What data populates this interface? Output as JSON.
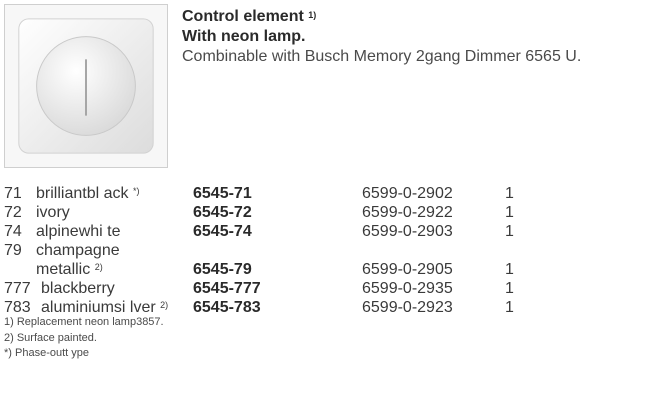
{
  "header": {
    "title": "Control element",
    "title_sup": "1)",
    "subtitle": "With neon lamp.",
    "description": "Combinable with Busch Memory 2gang Dimmer 6565 U."
  },
  "rows": [
    {
      "code": "71",
      "desc": "brilliantbl ack",
      "sup": "*)",
      "article": "6545-71",
      "number": "6599-0-2902",
      "qty": "1"
    },
    {
      "code": "72",
      "desc": "ivory",
      "article": "6545-72",
      "number": "6599-0-2922",
      "qty": "1"
    },
    {
      "code": "74",
      "desc": "alpinewhi te",
      "article": "6545-74",
      "number": "6599-0-2903",
      "qty": "1"
    },
    {
      "code": "79",
      "desc_line1": "champagne",
      "desc_line2": "metallic",
      "sup": "2)",
      "article": "6545-79",
      "number": "6599-0-2905",
      "qty": "1"
    },
    {
      "code": "777",
      "desc": "blackberry",
      "article": "6545-777",
      "number": "6599-0-2935",
      "qty": "1"
    },
    {
      "code": "783",
      "desc": "aluminiumsi lver",
      "sup": "2)",
      "article": "6545-783",
      "number": "6599-0-2923",
      "qty": "1"
    }
  ],
  "footnotes": [
    "1)  Replacement neon lamp3857.",
    "2)  Surface painted.",
    "*)  Phase-outt ype"
  ]
}
